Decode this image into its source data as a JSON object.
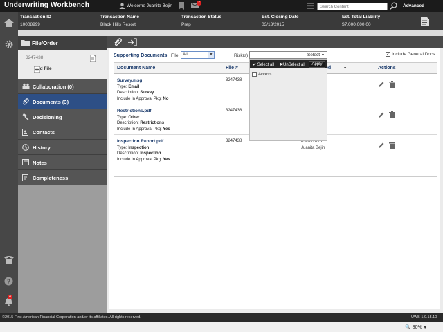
{
  "app": {
    "title": "Underwriting Workbench",
    "welcome": "Welcome Juanita Bejin",
    "mail_count": "2",
    "search_placeholder": "Search Content",
    "advanced_label": "Advanced"
  },
  "summary": {
    "columns": [
      {
        "label": "Transaction ID",
        "value": "10008999"
      },
      {
        "label": "Transaction Name",
        "value": "Black Hills Resort"
      },
      {
        "label": "Transaction Status",
        "value": "Prep"
      },
      {
        "label": "Est. Closing Date",
        "value": "03/13/2015"
      },
      {
        "label": "Est. Total Liability",
        "value": "$7,000,000.00"
      }
    ]
  },
  "rail": {
    "notification_count": "4"
  },
  "side": {
    "header": "File/Order",
    "file_number": "3247438",
    "add_file": "Add File",
    "nav": [
      {
        "label": "Collaboration (0)",
        "icon": "people-icon"
      },
      {
        "label": "Documents (3)",
        "icon": "paperclip-icon",
        "active": true
      },
      {
        "label": "Decisioning",
        "icon": "gavel-icon"
      },
      {
        "label": "Contacts",
        "icon": "contact-card-icon"
      },
      {
        "label": "History",
        "icon": "clock-icon"
      },
      {
        "label": "Notes",
        "icon": "note-icon"
      },
      {
        "label": "Completeness",
        "icon": "checklist-icon"
      }
    ]
  },
  "docs": {
    "section_label": "Supporting Documents",
    "file_label": "File",
    "file_value": "All",
    "risk_label": "Risk(s)",
    "risk_value": "Select",
    "include_general": "Include General Docs",
    "columns": {
      "name": "Document Name",
      "file": "File #",
      "date": "ed",
      "actions": "Actions"
    },
    "rows": [
      {
        "name": "Survey.msg",
        "type": "Email",
        "description": "Survey",
        "include": "No",
        "file": "3247438",
        "date": "",
        "user": ""
      },
      {
        "name": "Restrictions.pdf",
        "type": "Other",
        "description": "Restrictions",
        "include": "Yes",
        "file": "3247438",
        "date": "",
        "user": ""
      },
      {
        "name": "Inspection Report.pdf",
        "type": "Inspection",
        "description": "Inspection",
        "include": "Yes",
        "file": "3247438",
        "date": "03/18/2015",
        "user": "Juanita Bejin"
      }
    ],
    "field_labels": {
      "type": "Type: ",
      "description": "Description: ",
      "include": "Include In Approval Pkg: "
    }
  },
  "risk_dropdown": {
    "select_all": "Select all",
    "unselect_all": "UnSelect all",
    "apply": "Apply",
    "options": [
      "Access"
    ]
  },
  "footer": {
    "copyright": "©2015 First American Financial Corporation and/or its affiliates. All rights reserved.",
    "version": "UWB 1.0.15.10",
    "zoom": "80%"
  }
}
